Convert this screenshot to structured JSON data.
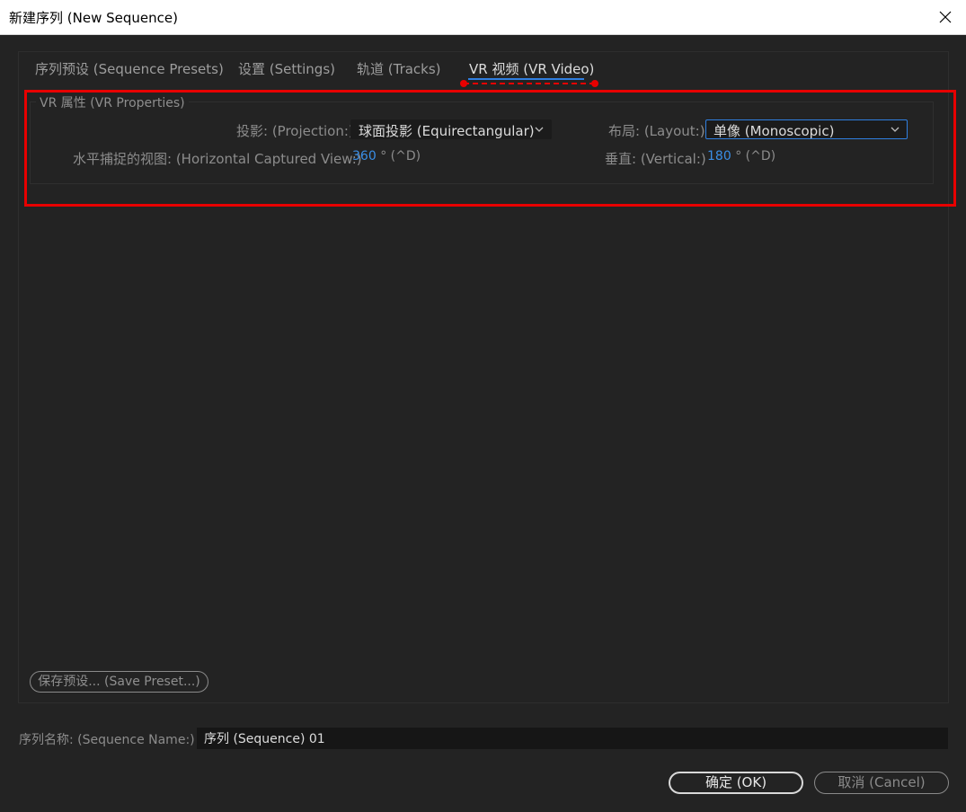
{
  "window": {
    "title": "新建序列 (New Sequence)",
    "close_glyph": "✕"
  },
  "tabs": [
    {
      "label": "序列预设 (Sequence Presets)",
      "active": false
    },
    {
      "label": "设置 (Settings)",
      "active": false
    },
    {
      "label": "轨道 (Tracks)",
      "active": false
    },
    {
      "label": "VR 视频 (VR Video)",
      "active": true
    }
  ],
  "vr_properties": {
    "group_title": "VR 属性 (VR Properties)",
    "projection_label": "投影: (Projection:)",
    "projection_value": "球面投影 (Equirectangular)",
    "layout_label": "布局: (Layout:)",
    "layout_value": "单像 (Monoscopic)",
    "horizontal_label": "水平捕捉的视图: (Horizontal Captured View:)",
    "horizontal_value": "360",
    "horizontal_unit": "° (^D)",
    "vertical_label": "垂直: (Vertical:)",
    "vertical_value": "180",
    "vertical_unit": "° (^D)"
  },
  "save_preset_label": "保存预设... (Save Preset...)",
  "sequence_name": {
    "label": "序列名称: (Sequence Name:)",
    "value": "序列 (Sequence) 01"
  },
  "buttons": {
    "ok": "确定 (OK)",
    "cancel": "取消 (Cancel)"
  },
  "colors": {
    "accent": "#2f7fe0",
    "annotation": "#e80000",
    "value_blue": "#3a8ee6",
    "background": "#232323"
  }
}
